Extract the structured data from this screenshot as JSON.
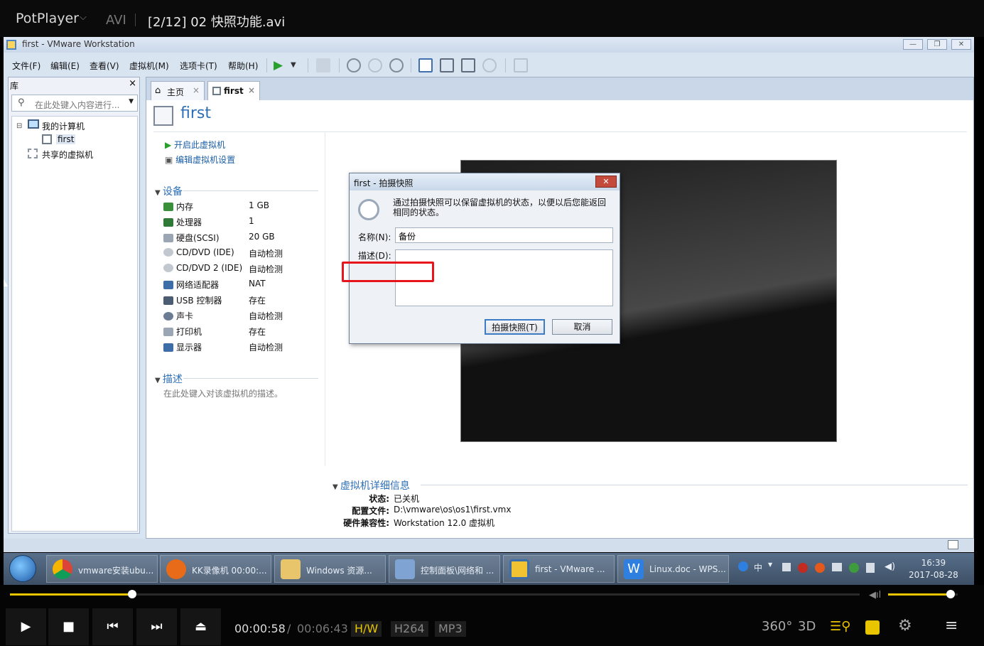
{
  "player": {
    "brand": "PotPlayer",
    "chevron": "⌵",
    "format": "AVI",
    "file_title": "[2/12] 02 快照功能.avi"
  },
  "vmware": {
    "window_title": "first - VMware Workstation",
    "menu": [
      "文件(F)",
      "编辑(E)",
      "查看(V)",
      "虚拟机(M)",
      "选项卡(T)",
      "帮助(H)"
    ],
    "library": {
      "title": "库",
      "close": "×",
      "search_placeholder": "在此处键入内容进行...",
      "tree": {
        "my_computer": "我的计算机",
        "vm_first": "first",
        "shared": "共享的虚拟机"
      }
    },
    "tabs": [
      {
        "label": "主页",
        "close": "×"
      },
      {
        "label": "first",
        "close": "×"
      }
    ],
    "vm_name": "first",
    "actions": {
      "power_on": "开启此虚拟机",
      "edit_settings": "编辑虚拟机设置"
    },
    "devices_title": "设备",
    "devices": [
      {
        "name": "内存",
        "value": "1 GB"
      },
      {
        "name": "处理器",
        "value": "1"
      },
      {
        "name": "硬盘(SCSI)",
        "value": "20 GB"
      },
      {
        "name": "CD/DVD (IDE)",
        "value": "自动检测"
      },
      {
        "name": "CD/DVD 2 (IDE)",
        "value": "自动检测"
      },
      {
        "name": "网络适配器",
        "value": "NAT"
      },
      {
        "name": "USB 控制器",
        "value": "存在"
      },
      {
        "name": "声卡",
        "value": "自动检测"
      },
      {
        "name": "打印机",
        "value": "存在"
      },
      {
        "name": "显示器",
        "value": "自动检测"
      }
    ],
    "desc_title": "描述",
    "desc_placeholder": "在此处键入对该虚拟机的描述。",
    "details_title": "虚拟机详细信息",
    "details": {
      "state_label": "状态:",
      "state_value": "已关机",
      "config_label": "配置文件:",
      "config_value": "D:\\vmware\\os\\os1\\first.vmx",
      "compat_label": "硬件兼容性:",
      "compat_value": "Workstation 12.0 虚拟机"
    }
  },
  "dialog": {
    "title": "first - 拍摄快照",
    "close": "✕",
    "info": "通过拍摄快照可以保留虚拟机的状态，以便以后您能返回相同的状态。",
    "name_label": "名称(N):",
    "name_value": "备份",
    "desc_label": "描述(D):",
    "ok": "拍摄快照(T)",
    "cancel": "取消"
  },
  "taskbar": {
    "items": [
      "vmware安装ubu...",
      "KK录像机 00:00:...",
      "Windows 资源...",
      "控制面板\\网络和 ...",
      "first - VMware ...",
      "Linux.doc - WPS..."
    ],
    "ime": "中",
    "time": "16:39",
    "date": "2017-08-28"
  },
  "controls": {
    "elapsed": "00:00:58",
    "slash": "/",
    "total": "00:06:43",
    "hw": "H/W",
    "codec": "H264",
    "audio": "MP3",
    "r360": "360°",
    "r3d": "3D",
    "progress": 0.144,
    "volume": 0.9
  }
}
